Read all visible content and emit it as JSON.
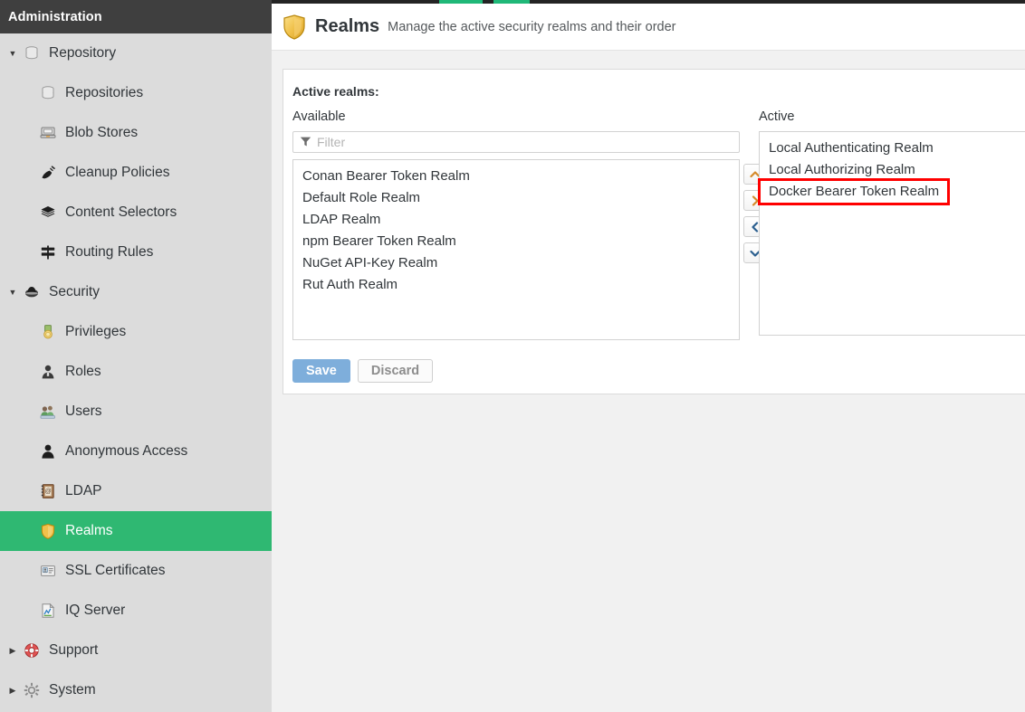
{
  "topbar": {
    "accent_color": "#1fb878",
    "bar_color": "#242424"
  },
  "sidebar": {
    "header": "Administration",
    "selected_color": "#2fb872",
    "items": [
      {
        "label": "Repository",
        "icon": "database-icon",
        "level": "parent",
        "expanded": true,
        "selected": false
      },
      {
        "label": "Repositories",
        "icon": "database-icon",
        "level": "child",
        "selected": false
      },
      {
        "label": "Blob Stores",
        "icon": "blob-store-icon",
        "level": "child",
        "selected": false
      },
      {
        "label": "Cleanup Policies",
        "icon": "broom-icon",
        "level": "child",
        "selected": false
      },
      {
        "label": "Content Selectors",
        "icon": "layers-icon",
        "level": "child",
        "selected": false
      },
      {
        "label": "Routing Rules",
        "icon": "signpost-icon",
        "level": "child",
        "selected": false
      },
      {
        "label": "Security",
        "icon": "security-shield-icon",
        "level": "parent",
        "expanded": true,
        "selected": false
      },
      {
        "label": "Privileges",
        "icon": "medal-icon",
        "level": "child",
        "selected": false
      },
      {
        "label": "Roles",
        "icon": "role-person-icon",
        "level": "child",
        "selected": false
      },
      {
        "label": "Users",
        "icon": "users-icon",
        "level": "child",
        "selected": false
      },
      {
        "label": "Anonymous Access",
        "icon": "person-icon",
        "level": "child",
        "selected": false
      },
      {
        "label": "LDAP",
        "icon": "address-book-icon",
        "level": "child",
        "selected": false
      },
      {
        "label": "Realms",
        "icon": "shield-icon",
        "level": "child",
        "selected": true
      },
      {
        "label": "SSL Certificates",
        "icon": "certificate-icon",
        "level": "child",
        "selected": false
      },
      {
        "label": "IQ Server",
        "icon": "iq-server-icon",
        "level": "child",
        "selected": false
      },
      {
        "label": "Support",
        "icon": "lifebuoy-icon",
        "level": "parent",
        "expanded": false,
        "selected": false
      },
      {
        "label": "System",
        "icon": "gear-icon",
        "level": "parent",
        "expanded": false,
        "selected": false
      }
    ]
  },
  "page": {
    "icon": "shield-icon",
    "title": "Realms",
    "subtitle": "Manage the active security realms and their order"
  },
  "realms": {
    "section_title": "Active realms:",
    "available_label": "Available",
    "active_label": "Active",
    "filter_placeholder": "Filter",
    "filter_value": "",
    "filter_icon": "funnel-icon",
    "available": [
      "Conan Bearer Token Realm",
      "Default Role Realm",
      "LDAP Realm",
      "npm Bearer Token Realm",
      "NuGet API-Key Realm",
      "Rut Auth Realm"
    ],
    "active": [
      "Local Authenticating Realm",
      "Local Authorizing Realm",
      "Docker Bearer Token Realm"
    ],
    "highlighted_active_item": "Docker Bearer Token Realm",
    "highlight_color": "#ff0000",
    "transfer_buttons": [
      {
        "name": "move-up-button",
        "icon": "chevron-up-icon"
      },
      {
        "name": "move-right-button",
        "icon": "chevron-right-icon"
      },
      {
        "name": "move-left-button",
        "icon": "chevron-left-icon"
      },
      {
        "name": "move-down-button",
        "icon": "chevron-down-icon"
      }
    ]
  },
  "actions": {
    "save_label": "Save",
    "discard_label": "Discard",
    "save_color": "#7eaedb"
  }
}
